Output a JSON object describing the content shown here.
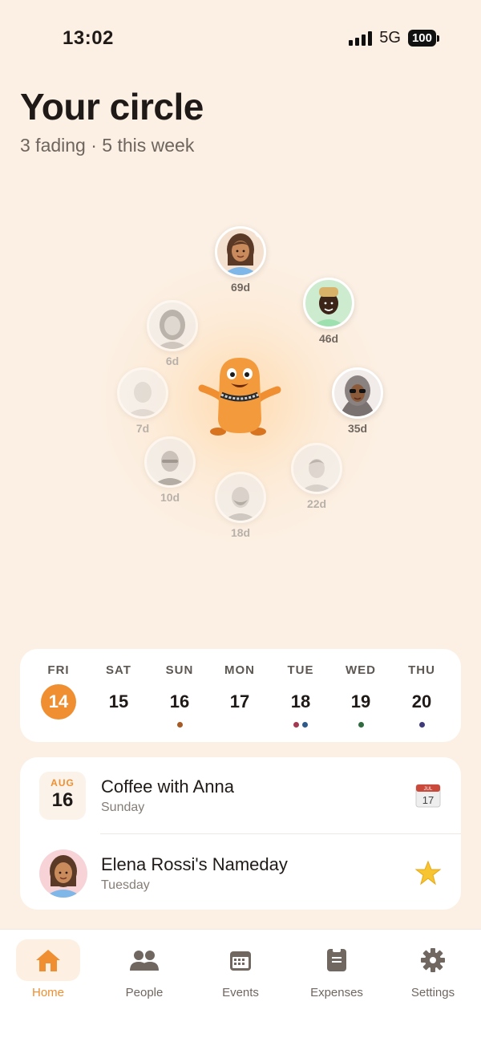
{
  "status": {
    "time": "13:02",
    "network": "5G",
    "battery": "100"
  },
  "header": {
    "title": "Your circle",
    "subtitle": "3 fading · 5 this week"
  },
  "circle": {
    "friends": [
      {
        "days": "69d",
        "faded": false
      },
      {
        "days": "46d",
        "faded": false
      },
      {
        "days": "35d",
        "faded": false
      },
      {
        "days": "22d",
        "faded": true
      },
      {
        "days": "18d",
        "faded": true
      },
      {
        "days": "10d",
        "faded": true
      },
      {
        "days": "7d",
        "faded": true
      },
      {
        "days": "6d",
        "faded": true
      }
    ]
  },
  "week": {
    "days": [
      {
        "name": "FRI",
        "num": "14",
        "today": true,
        "dots": []
      },
      {
        "name": "SAT",
        "num": "15",
        "today": false,
        "dots": []
      },
      {
        "name": "SUN",
        "num": "16",
        "today": false,
        "dots": [
          "#a65a25"
        ]
      },
      {
        "name": "MON",
        "num": "17",
        "today": false,
        "dots": []
      },
      {
        "name": "TUE",
        "num": "18",
        "today": false,
        "dots": [
          "#a23a52",
          "#2e5a8a"
        ]
      },
      {
        "name": "WED",
        "num": "19",
        "today": false,
        "dots": [
          "#2f6b3e"
        ]
      },
      {
        "name": "THU",
        "num": "20",
        "today": false,
        "dots": [
          "#3f3b7a"
        ]
      }
    ]
  },
  "events": [
    {
      "month": "AUG",
      "day": "16",
      "title": "Coffee with Anna",
      "subtitle": "Sunday",
      "icon": "calendar-icon",
      "icon_text": "17",
      "icon_month": "JUL"
    },
    {
      "title": "Elena Rossi's Nameday",
      "subtitle": "Tuesday",
      "icon": "star-icon"
    }
  ],
  "tabs": [
    {
      "label": "Home",
      "icon": "home-icon",
      "active": true
    },
    {
      "label": "People",
      "icon": "people-icon",
      "active": false
    },
    {
      "label": "Events",
      "icon": "calendar-icon",
      "active": false
    },
    {
      "label": "Expenses",
      "icon": "receipt-icon",
      "active": false
    },
    {
      "label": "Settings",
      "icon": "gear-icon",
      "active": false
    }
  ],
  "colors": {
    "accent": "#ef8f32",
    "background": "#fcf0e4"
  }
}
